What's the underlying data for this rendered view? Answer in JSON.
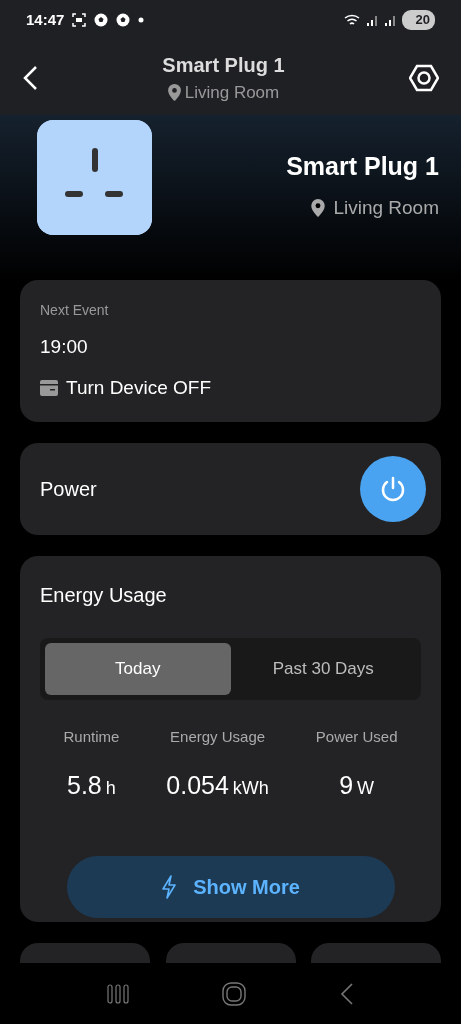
{
  "status_bar": {
    "time": "14:47",
    "battery": "20"
  },
  "header": {
    "title": "Smart Plug 1",
    "location": "Living Room"
  },
  "device": {
    "name": "Smart Plug 1",
    "location": "Living Room"
  },
  "next_event": {
    "label": "Next Event",
    "time": "19:00",
    "action": "Turn Device OFF"
  },
  "power": {
    "label": "Power",
    "on": true
  },
  "energy": {
    "title": "Energy Usage",
    "tabs": [
      {
        "label": "Today",
        "selected": true
      },
      {
        "label": "Past 30 Days",
        "selected": false
      }
    ],
    "stats": [
      {
        "label": "Runtime",
        "value": "5.8",
        "unit": "h"
      },
      {
        "label": "Energy Usage",
        "value": "0.054",
        "unit": "kWh"
      },
      {
        "label": "Power Used",
        "value": "9",
        "unit": "W"
      }
    ],
    "button": "Show More"
  }
}
